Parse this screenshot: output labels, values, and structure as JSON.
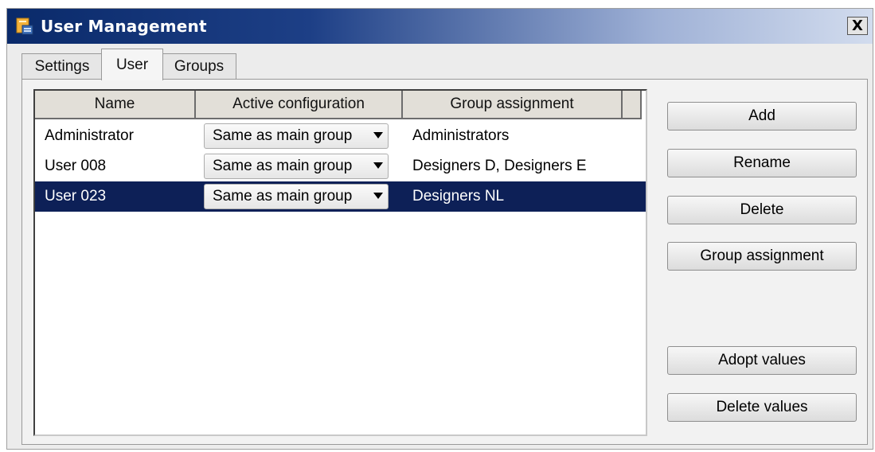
{
  "window": {
    "title": "User Management",
    "close_label": "X"
  },
  "tabs": [
    {
      "label": "Settings",
      "active": false
    },
    {
      "label": "User",
      "active": true
    },
    {
      "label": "Groups",
      "active": false
    }
  ],
  "table": {
    "columns": [
      "Name",
      "Active configuration",
      "Group assignment"
    ],
    "rows": [
      {
        "name": "Administrator",
        "configuration": "Same as main group",
        "group": "Administrators",
        "selected": false
      },
      {
        "name": "User 008",
        "configuration": "Same as main group",
        "group": "Designers D, Designers E",
        "selected": false
      },
      {
        "name": "User 023",
        "configuration": "Same as main group",
        "group": "Designers NL",
        "selected": true
      }
    ]
  },
  "buttons": {
    "add": "Add",
    "rename": "Rename",
    "delete": "Delete",
    "group_assignment": "Group assignment",
    "adopt_values": "Adopt values",
    "delete_values": "Delete values"
  },
  "colors": {
    "title_bar_dark": "#0a2a6a",
    "selection": "#0d2057"
  },
  "icons": {
    "app": "user-management-icon",
    "combo_arrow": "chevron-down-icon"
  }
}
